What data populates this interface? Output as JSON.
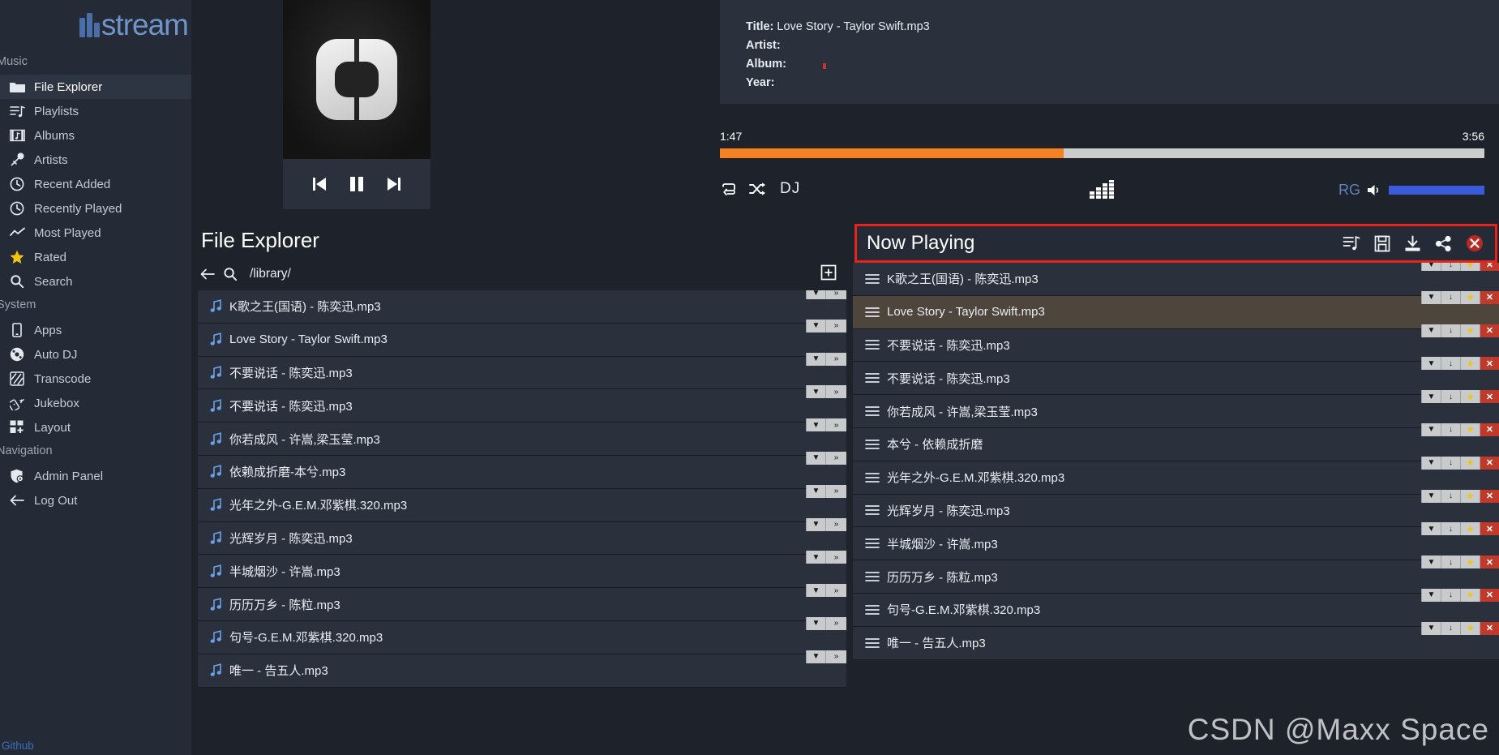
{
  "brand": {
    "name": "stream",
    "logo_icon": "bars-logo-icon"
  },
  "sidebar": {
    "sections": [
      {
        "label": "Music",
        "items": [
          {
            "label": "File Explorer",
            "icon": "folder-icon",
            "active": true
          },
          {
            "label": "Playlists",
            "icon": "playlist-icon",
            "active": false
          },
          {
            "label": "Albums",
            "icon": "album-icon",
            "active": false
          },
          {
            "label": "Artists",
            "icon": "microphone-icon",
            "active": false
          },
          {
            "label": "Recent Added",
            "icon": "clock-icon",
            "active": false
          },
          {
            "label": "Recently Played",
            "icon": "clock-icon",
            "active": false
          },
          {
            "label": "Most Played",
            "icon": "trending-up-icon",
            "active": false
          },
          {
            "label": "Rated",
            "icon": "star-icon",
            "active": false
          },
          {
            "label": "Search",
            "icon": "search-icon",
            "active": false
          }
        ]
      },
      {
        "label": "System",
        "items": [
          {
            "label": "Apps",
            "icon": "mobile-phone-icon",
            "active": false
          },
          {
            "label": "Auto DJ",
            "icon": "disc-icon",
            "active": false
          },
          {
            "label": "Transcode",
            "icon": "transcode-icon",
            "active": false
          },
          {
            "label": "Jukebox",
            "icon": "remote-control-icon",
            "active": false
          },
          {
            "label": "Layout",
            "icon": "layout-grid-plus-icon",
            "active": false
          }
        ]
      },
      {
        "label": "Navigation",
        "items": [
          {
            "label": "Admin Panel",
            "icon": "shield-lock-icon",
            "active": false
          },
          {
            "label": "Log Out",
            "icon": "arrow-left-icon",
            "active": false
          }
        ]
      }
    ],
    "github_link": "Github"
  },
  "player": {
    "album_art_icon": "default-album-art-icon",
    "transport": {
      "previous": "previous-track-icon",
      "pause": "pause-icon",
      "next": "next-track-icon"
    },
    "metadata": [
      {
        "label": "Title:",
        "value": "Love Story - Taylor Swift.mp3"
      },
      {
        "label": "Artist:",
        "value": ""
      },
      {
        "label": "Album:",
        "value": ""
      },
      {
        "label": "Year:",
        "value": ""
      }
    ],
    "elapsed": "1:47",
    "duration": "3:56",
    "progress_percent": 45,
    "progress_fill_color": "#f58220",
    "controls": {
      "repeat": "repeat-icon",
      "shuffle": "shuffle-icon",
      "dj_label": "DJ",
      "equalizer": "equalizer-icon",
      "replay_gain_label": "RG",
      "replay_gain_color": "#5d82b9",
      "volume_icon": "volume-icon",
      "volume_percent": 100,
      "volume_color": "#3b5bdb"
    }
  },
  "file_explorer": {
    "title": "File Explorer",
    "back_icon": "arrow-left-icon",
    "search_icon": "search-icon",
    "path": "/library/",
    "add_icon": "add-folder-icon",
    "row_buttons": [
      {
        "name": "dropdown",
        "glyph": "▼"
      },
      {
        "name": "expand",
        "glyph": "»"
      }
    ],
    "files": [
      {
        "name": "K歌之王(国语) - 陈奕迅.mp3",
        "icon": "music-note-icon"
      },
      {
        "name": "Love Story - Taylor Swift.mp3",
        "icon": "music-note-icon"
      },
      {
        "name": "不要说话 - 陈奕迅.mp3",
        "icon": "music-note-icon"
      },
      {
        "name": "不要说话 - 陈奕迅.mp3",
        "icon": "music-note-icon"
      },
      {
        "name": "你若成风 - 许嵩,梁玉莹.mp3",
        "icon": "music-note-icon"
      },
      {
        "name": "依赖成折磨-本兮.mp3",
        "icon": "music-note-icon"
      },
      {
        "name": "光年之外-G.E.M.邓紫棋.320.mp3",
        "icon": "music-note-icon"
      },
      {
        "name": "光辉岁月 - 陈奕迅.mp3",
        "icon": "music-note-icon"
      },
      {
        "name": "半城烟沙 - 许嵩.mp3",
        "icon": "music-note-icon"
      },
      {
        "name": "历历万乡 - 陈粒.mp3",
        "icon": "music-note-icon"
      },
      {
        "name": "句号-G.E.M.邓紫棋.320.mp3",
        "icon": "music-note-icon"
      },
      {
        "name": "唯一 - 告五人.mp3",
        "icon": "music-note-icon"
      }
    ]
  },
  "now_playing": {
    "title": "Now Playing",
    "border_color": "#e8231c",
    "actions": [
      {
        "name": "save-playlist-icon",
        "glyph": "playlist"
      },
      {
        "name": "save-icon",
        "glyph": "floppy"
      },
      {
        "name": "download-icon",
        "glyph": "download"
      },
      {
        "name": "share-icon",
        "glyph": "share"
      },
      {
        "name": "close-icon",
        "glyph": "x"
      }
    ],
    "row_buttons": [
      {
        "name": "dropdown",
        "glyph": "▼"
      },
      {
        "name": "download",
        "glyph": "↓"
      },
      {
        "name": "favorite",
        "glyph": "★"
      },
      {
        "name": "remove",
        "glyph": "✕"
      }
    ],
    "tracks": [
      {
        "name": "K歌之王(国语) - 陈奕迅.mp3",
        "playing": false
      },
      {
        "name": "Love Story - Taylor Swift.mp3",
        "playing": true
      },
      {
        "name": "不要说话 - 陈奕迅.mp3",
        "playing": false
      },
      {
        "name": "不要说话 - 陈奕迅.mp3",
        "playing": false
      },
      {
        "name": "你若成风 - 许嵩,梁玉莹.mp3",
        "playing": false
      },
      {
        "name": "本兮 - 依赖成折磨",
        "playing": false
      },
      {
        "name": "光年之外-G.E.M.邓紫棋.320.mp3",
        "playing": false
      },
      {
        "name": "光辉岁月 - 陈奕迅.mp3",
        "playing": false
      },
      {
        "name": "半城烟沙 - 许嵩.mp3",
        "playing": false
      },
      {
        "name": "历历万乡 - 陈粒.mp3",
        "playing": false
      },
      {
        "name": "句号-G.E.M.邓紫棋.320.mp3",
        "playing": false
      },
      {
        "name": "唯一 - 告五人.mp3",
        "playing": false
      }
    ]
  },
  "watermark": "CSDN @Maxx Space"
}
